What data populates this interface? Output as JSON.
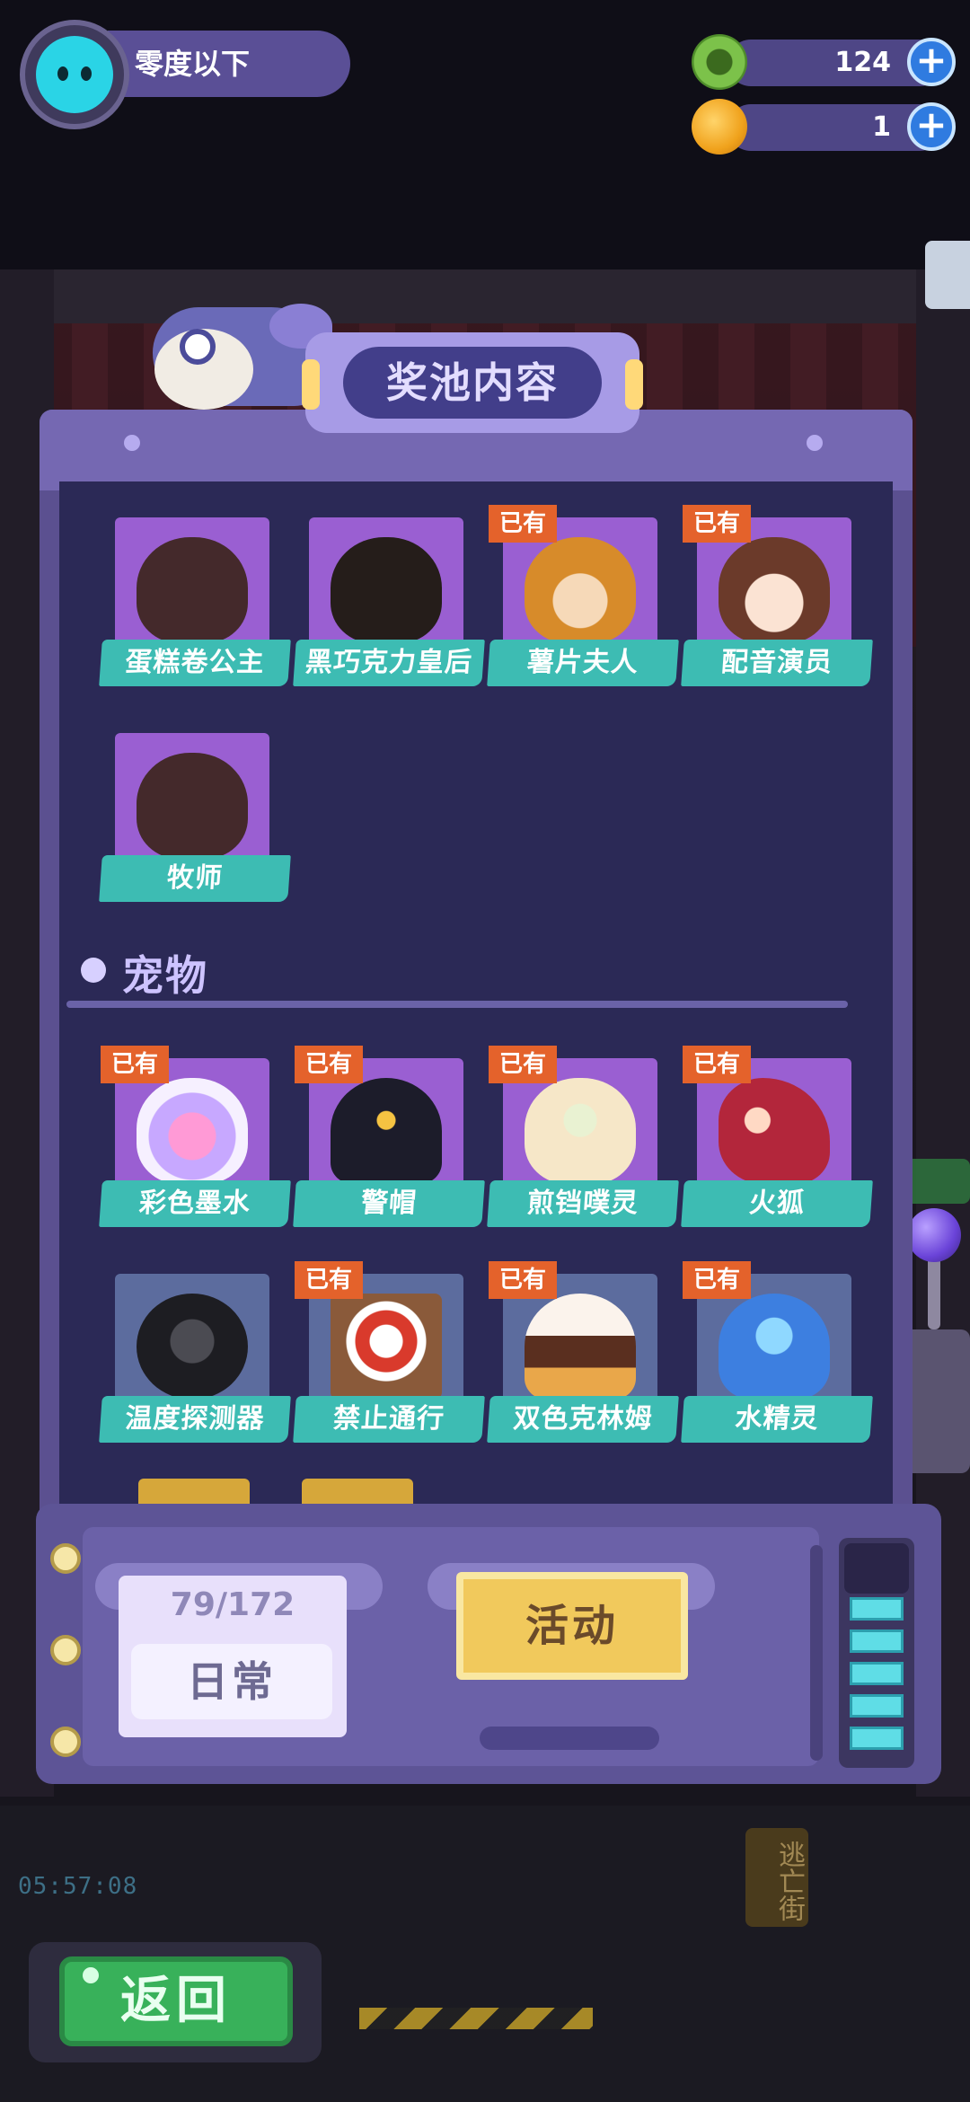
{
  "user": {
    "name": "零度以下"
  },
  "currencies": [
    {
      "icon": "green-donut-coin-icon",
      "value": "124",
      "color": "#7cc24a"
    },
    {
      "icon": "orange-planet-icon",
      "value": "1",
      "color": "#f0a21c"
    }
  ],
  "panel": {
    "title": "奖池内容"
  },
  "owned_badge": "已有",
  "characters": [
    {
      "name": "蛋糕卷公主",
      "owned": false
    },
    {
      "name": "黑巧克力皇后",
      "owned": false
    },
    {
      "name": "薯片夫人",
      "owned": true
    },
    {
      "name": "配音演员",
      "owned": true
    },
    {
      "name": "牧师",
      "owned": false
    }
  ],
  "pets_section": {
    "title": "宠物",
    "items": [
      {
        "name": "彩色墨水",
        "owned": true
      },
      {
        "name": "警帽",
        "owned": true
      },
      {
        "name": "煎铛噗灵",
        "owned": true
      },
      {
        "name": "火狐",
        "owned": true
      },
      {
        "name": "温度探测器",
        "owned": false
      },
      {
        "name": "禁止通行",
        "owned": true
      },
      {
        "name": "双色克林姆",
        "owned": true
      },
      {
        "name": "水精灵",
        "owned": true
      }
    ]
  },
  "console": {
    "progress_text": "79/172",
    "daily_label": "日常",
    "event_label": "活动",
    "meter_cells_lit": 5
  },
  "back_label": "返回",
  "background": {
    "clock": "05:57:08",
    "sign": "逃亡街"
  },
  "colors": {
    "owned_badge": "#e4622b",
    "label_teal": "#3dbcb3",
    "panel_purple": "#5b5090",
    "back_green": "#38b15a",
    "event_yellow": "#f1c95c"
  }
}
